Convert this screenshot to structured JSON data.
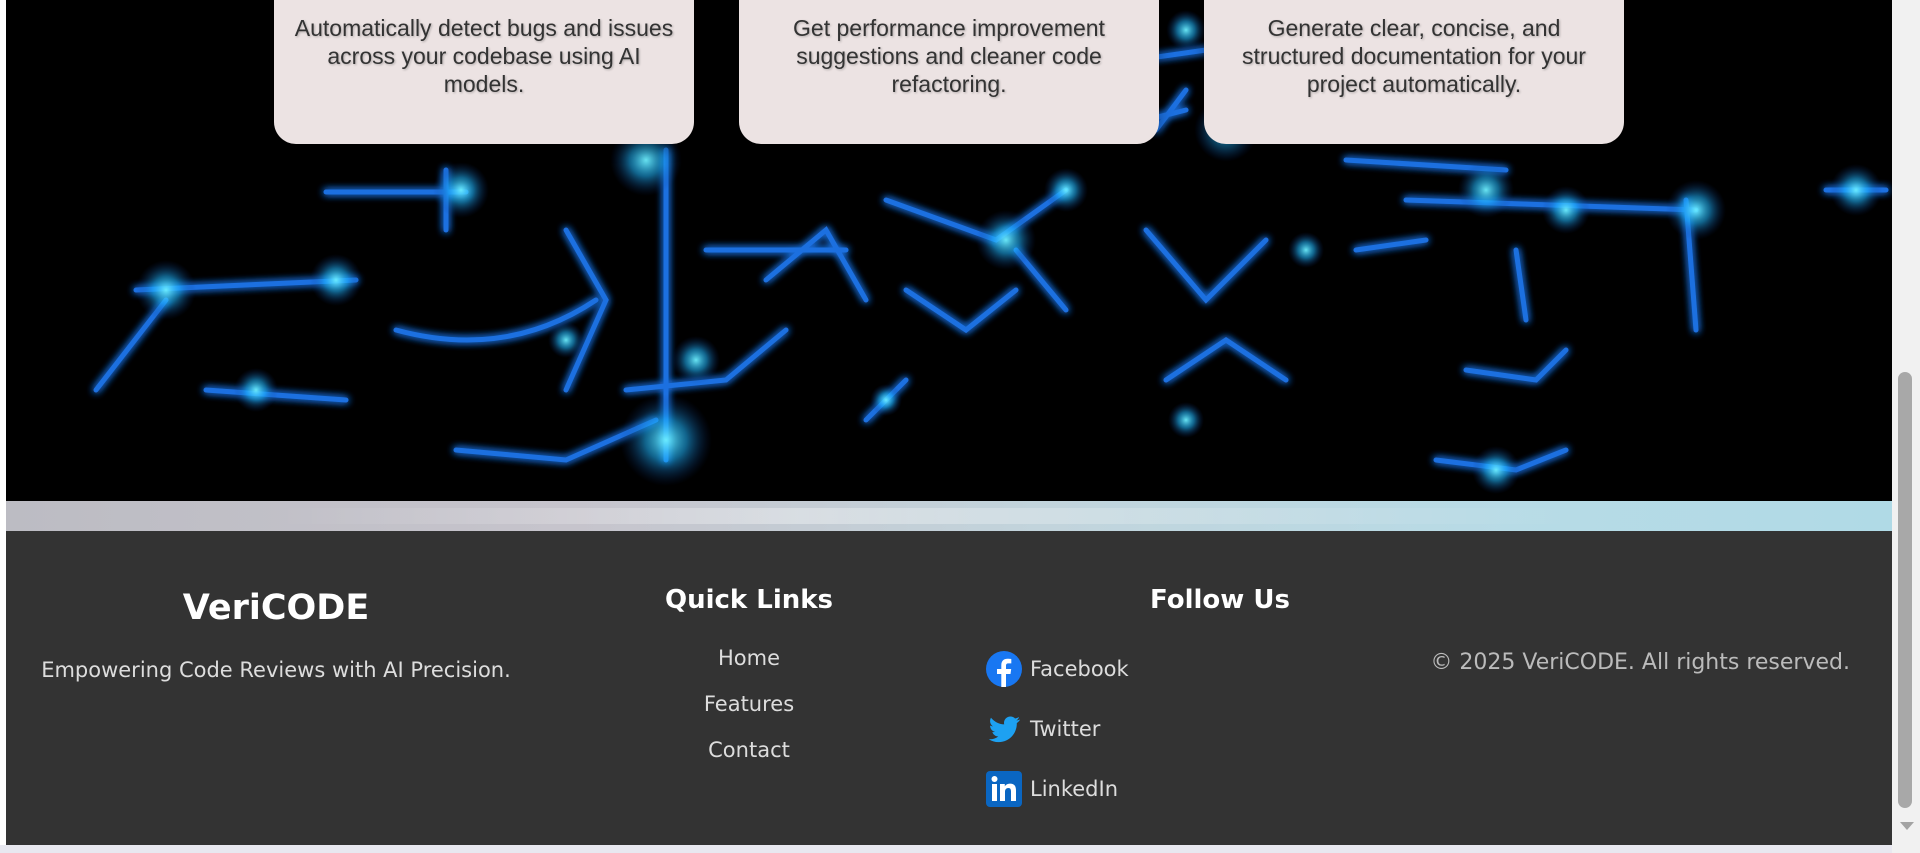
{
  "features": [
    {
      "description": "Automatically detect bugs and issues across your codebase using AI models."
    },
    {
      "description": "Get performance improvement suggestions and cleaner code refactoring."
    },
    {
      "description": "Generate clear, concise, and structured documentation for your project automatically."
    }
  ],
  "footer": {
    "brand": {
      "name": "VeriCODE",
      "tagline": "Empowering Code Reviews with AI Precision."
    },
    "quick_links": {
      "title": "Quick Links",
      "items": [
        "Home",
        "Features",
        "Contact"
      ]
    },
    "follow": {
      "title": "Follow Us",
      "items": [
        {
          "label": "Facebook",
          "icon": "facebook-icon"
        },
        {
          "label": "Twitter",
          "icon": "twitter-icon"
        },
        {
          "label": "LinkedIn",
          "icon": "linkedin-icon"
        }
      ]
    },
    "copyright": "© 2025 VeriCODE. All rights reserved."
  },
  "colors": {
    "footer_bg": "#333333",
    "card_bg": "#ece3e3",
    "hero_bg": "#000000",
    "glow": "#1ec8ff",
    "facebook": "#1877f2",
    "twitter": "#1da1f2",
    "linkedin": "#0a66c2"
  }
}
